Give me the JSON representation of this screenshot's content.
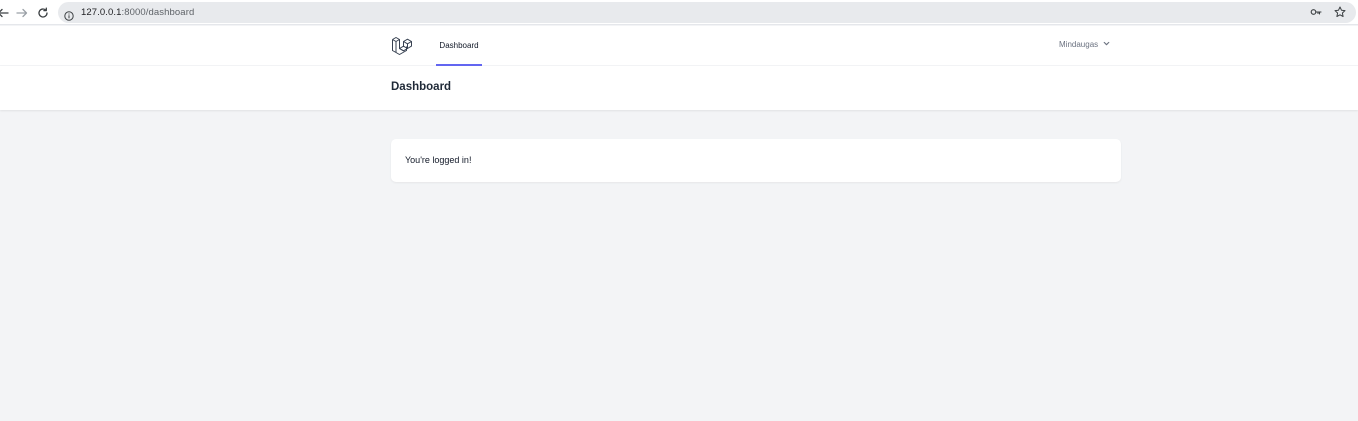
{
  "browser": {
    "url_host": "127.0.0.1",
    "url_path": ":8000/dashboard"
  },
  "nav": {
    "dashboard_label": "Dashboard",
    "user_name": "Mindaugas"
  },
  "header": {
    "title": "Dashboard"
  },
  "content": {
    "message": "You're logged in!"
  },
  "colors": {
    "accent": "#6366f1",
    "page_bg": "#f3f4f6"
  }
}
